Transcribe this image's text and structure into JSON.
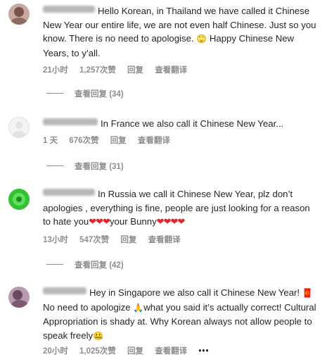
{
  "comments": [
    {
      "text_line1": "Hello Korean, in Thailand we have called it",
      "text_rest": "Chinese New Year our entire life, we are not even half Chinese. Just so you know. There is no need to apologise. ",
      "text_after_emoji": "Happy Chinese New Years, to y’all.",
      "emoji": "🙄",
      "time": "21小时",
      "likes": "1,257次赞",
      "reply": "回复",
      "translate": "查看翻译",
      "view_replies": "查看回复 (34)",
      "avatar_color": "#9b7a74"
    },
    {
      "text": "In France we also call it Chinese New Year...",
      "time": "1 天",
      "likes": "676次赞",
      "reply": "回复",
      "translate": "查看翻译",
      "view_replies": "查看回复 (31)",
      "avatar_color": "#eeeeee"
    },
    {
      "text_before": "In Russia we call it Chinese New Year, plz don’t apologies , everything is fine, people are just looking for a reason to hate you",
      "hearts1": "❤❤❤",
      "text_mid": "your Bunny",
      "hearts2": "❤❤❤❤",
      "time": "13小时",
      "likes": "547次赞",
      "reply": "回复",
      "translate": "查看翻译",
      "view_replies": "查看回复 (42)",
      "avatar_color": "#2fbf2f"
    },
    {
      "text_line1": "Hey in Singapore we also call it Chinese New Year!",
      "envelope": "🧧",
      "text_a": " No need to apologize ",
      "pray": "🙏",
      "text_b": "what you said it’s actually correct! Cultural Appropriation is shady at. Why Korean always not allow people to speak freely",
      "face": "🤐",
      "time": "20小时",
      "likes": "1,025次赞",
      "reply": "回复",
      "translate": "查看翻译",
      "more": "•••",
      "avatar_color": "#8a6a80"
    }
  ]
}
